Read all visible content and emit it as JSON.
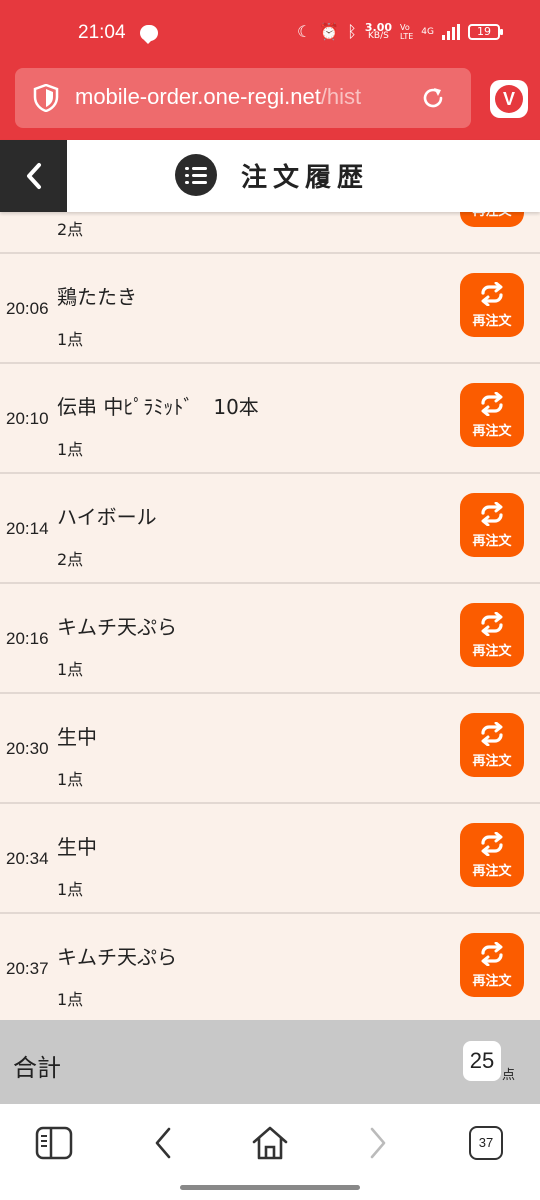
{
  "status_bar": {
    "time": "21:04",
    "net_speed": "3.00",
    "net_unit": "KB/S",
    "volte_top": "Vo",
    "volte_bottom": "LTE",
    "network": "4G",
    "battery": "19"
  },
  "browser": {
    "url_main": "mobile-order.one-regi.net",
    "url_path": "/hist"
  },
  "header": {
    "title": "注文履歴"
  },
  "orders": [
    {
      "time": "",
      "name": "",
      "qty": "2点",
      "reorder_label": "再注文"
    },
    {
      "time": "20:06",
      "name": "鶏たたき",
      "qty": "1点",
      "reorder_label": "再注文"
    },
    {
      "time": "20:10",
      "name": "伝串 中ﾋﾟﾗﾐｯﾄﾞ　10本",
      "qty": "1点",
      "reorder_label": "再注文"
    },
    {
      "time": "20:14",
      "name": "ハイボール",
      "qty": "2点",
      "reorder_label": "再注文"
    },
    {
      "time": "20:16",
      "name": "キムチ天ぷら",
      "qty": "1点",
      "reorder_label": "再注文"
    },
    {
      "time": "20:30",
      "name": "生中",
      "qty": "1点",
      "reorder_label": "再注文"
    },
    {
      "time": "20:34",
      "name": "生中",
      "qty": "1点",
      "reorder_label": "再注文"
    },
    {
      "time": "20:37",
      "name": "キムチ天ぷら",
      "qty": "1点",
      "reorder_label": "再注文"
    }
  ],
  "total": {
    "label": "合計",
    "count": "25",
    "unit": "点"
  },
  "bottom_nav": {
    "tab_count": "37"
  },
  "colors": {
    "brand_red": "#e6393e",
    "reorder_orange": "#fb5c00",
    "list_bg": "#fbf1ea"
  }
}
